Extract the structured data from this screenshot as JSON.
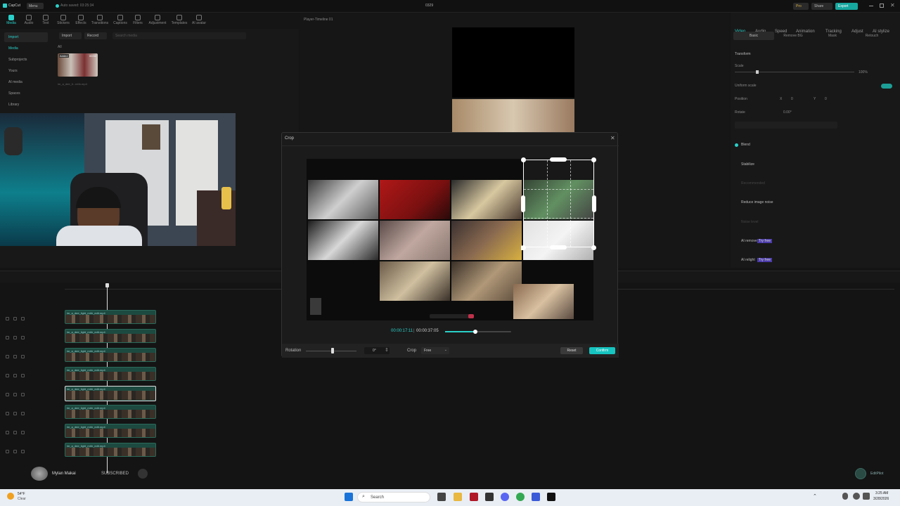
{
  "app": {
    "name": "CapCut",
    "menu_label": "Menu",
    "autosave": "Auto saved: 03:25:34",
    "project_title": "0329",
    "pro_label": "Pro",
    "share_label": "Share",
    "export_label": "Export"
  },
  "toolbar": [
    {
      "label": "Media"
    },
    {
      "label": "Audio"
    },
    {
      "label": "Text"
    },
    {
      "label": "Stickers"
    },
    {
      "label": "Effects"
    },
    {
      "label": "Transitions"
    },
    {
      "label": "Captions"
    },
    {
      "label": "Filters"
    },
    {
      "label": "Adjustment"
    },
    {
      "label": "Templates"
    },
    {
      "label": "AI avatar"
    }
  ],
  "sidebar": {
    "items": [
      {
        "label": "Import"
      },
      {
        "label": "Media"
      },
      {
        "label": "Subprojects"
      },
      {
        "label": "Yours"
      },
      {
        "label": "AI media"
      },
      {
        "label": "Spaces"
      },
      {
        "label": "Library"
      }
    ]
  },
  "media": {
    "import_label": "Import",
    "record_label": "Record",
    "search_placeholder": "Search media",
    "filter_all": "All",
    "thumb_badge": "Added",
    "thumb_duration": "00:52",
    "thumb_name": "im_a_dee_ti...mhh.mp4"
  },
  "player": {
    "title": "Player-Timeline 01"
  },
  "right_panel": {
    "tabs": [
      {
        "label": "Video"
      },
      {
        "label": "Audio"
      },
      {
        "label": "Speed"
      },
      {
        "label": "Animation"
      },
      {
        "label": "Tracking"
      },
      {
        "label": "Adjust"
      },
      {
        "label": "AI stylize"
      }
    ],
    "subtabs": [
      {
        "label": "Basic"
      },
      {
        "label": "Remove BG"
      },
      {
        "label": "Mask"
      },
      {
        "label": "Retouch"
      }
    ],
    "transform_label": "Transform",
    "scale_label": "Scale",
    "scale_value": "100%",
    "uniform_scale_label": "Uniform scale",
    "position_label": "Position",
    "pos_x_axis": "X",
    "pos_x": "0",
    "pos_y_axis": "Y",
    "pos_y": "0",
    "rotate_label": "Rotate",
    "rotate_value": "0.00°",
    "blend_label": "Blend",
    "stabilize_label": "Stabilize",
    "stabilize_level": "Recommended",
    "reduce_noise_label": "Reduce image noise",
    "noise_level": "Noise level",
    "ai_remove_label": "AI remove",
    "ai_relight_label": "AI relight",
    "try_free": "Try free"
  },
  "dialog": {
    "title": "Crop",
    "time_current": "00:00:17:11",
    "time_total": "00:00:37:05",
    "playback_progress": 0.46,
    "rotation_label": "Rotation",
    "rotation_value": "0°",
    "crop_label": "Crop",
    "crop_ratio": "Free",
    "reset_label": "Reset",
    "confirm_label": "Confirm"
  },
  "timeline": {
    "track_name": "im_a_dee_light_mhh_edit.mp4",
    "track_time": "00:00:37:05",
    "track_count": 8,
    "selected_track": 4
  },
  "overlay": {
    "channel_name": "Mylan Makai",
    "subscribed_label": "SUBSCRIBED",
    "watermark": "EditPilot"
  },
  "taskbar": {
    "weather_temp": "54°F",
    "weather_desc": "Clear",
    "search_label": "Search",
    "time": "3:25 AM",
    "date": "3/28/2026"
  },
  "colors": {
    "accent": "#2ad0c9",
    "confirm": "#16c4c0",
    "track": "#1d4a40",
    "dialog_bg": "#1b1b1b"
  }
}
